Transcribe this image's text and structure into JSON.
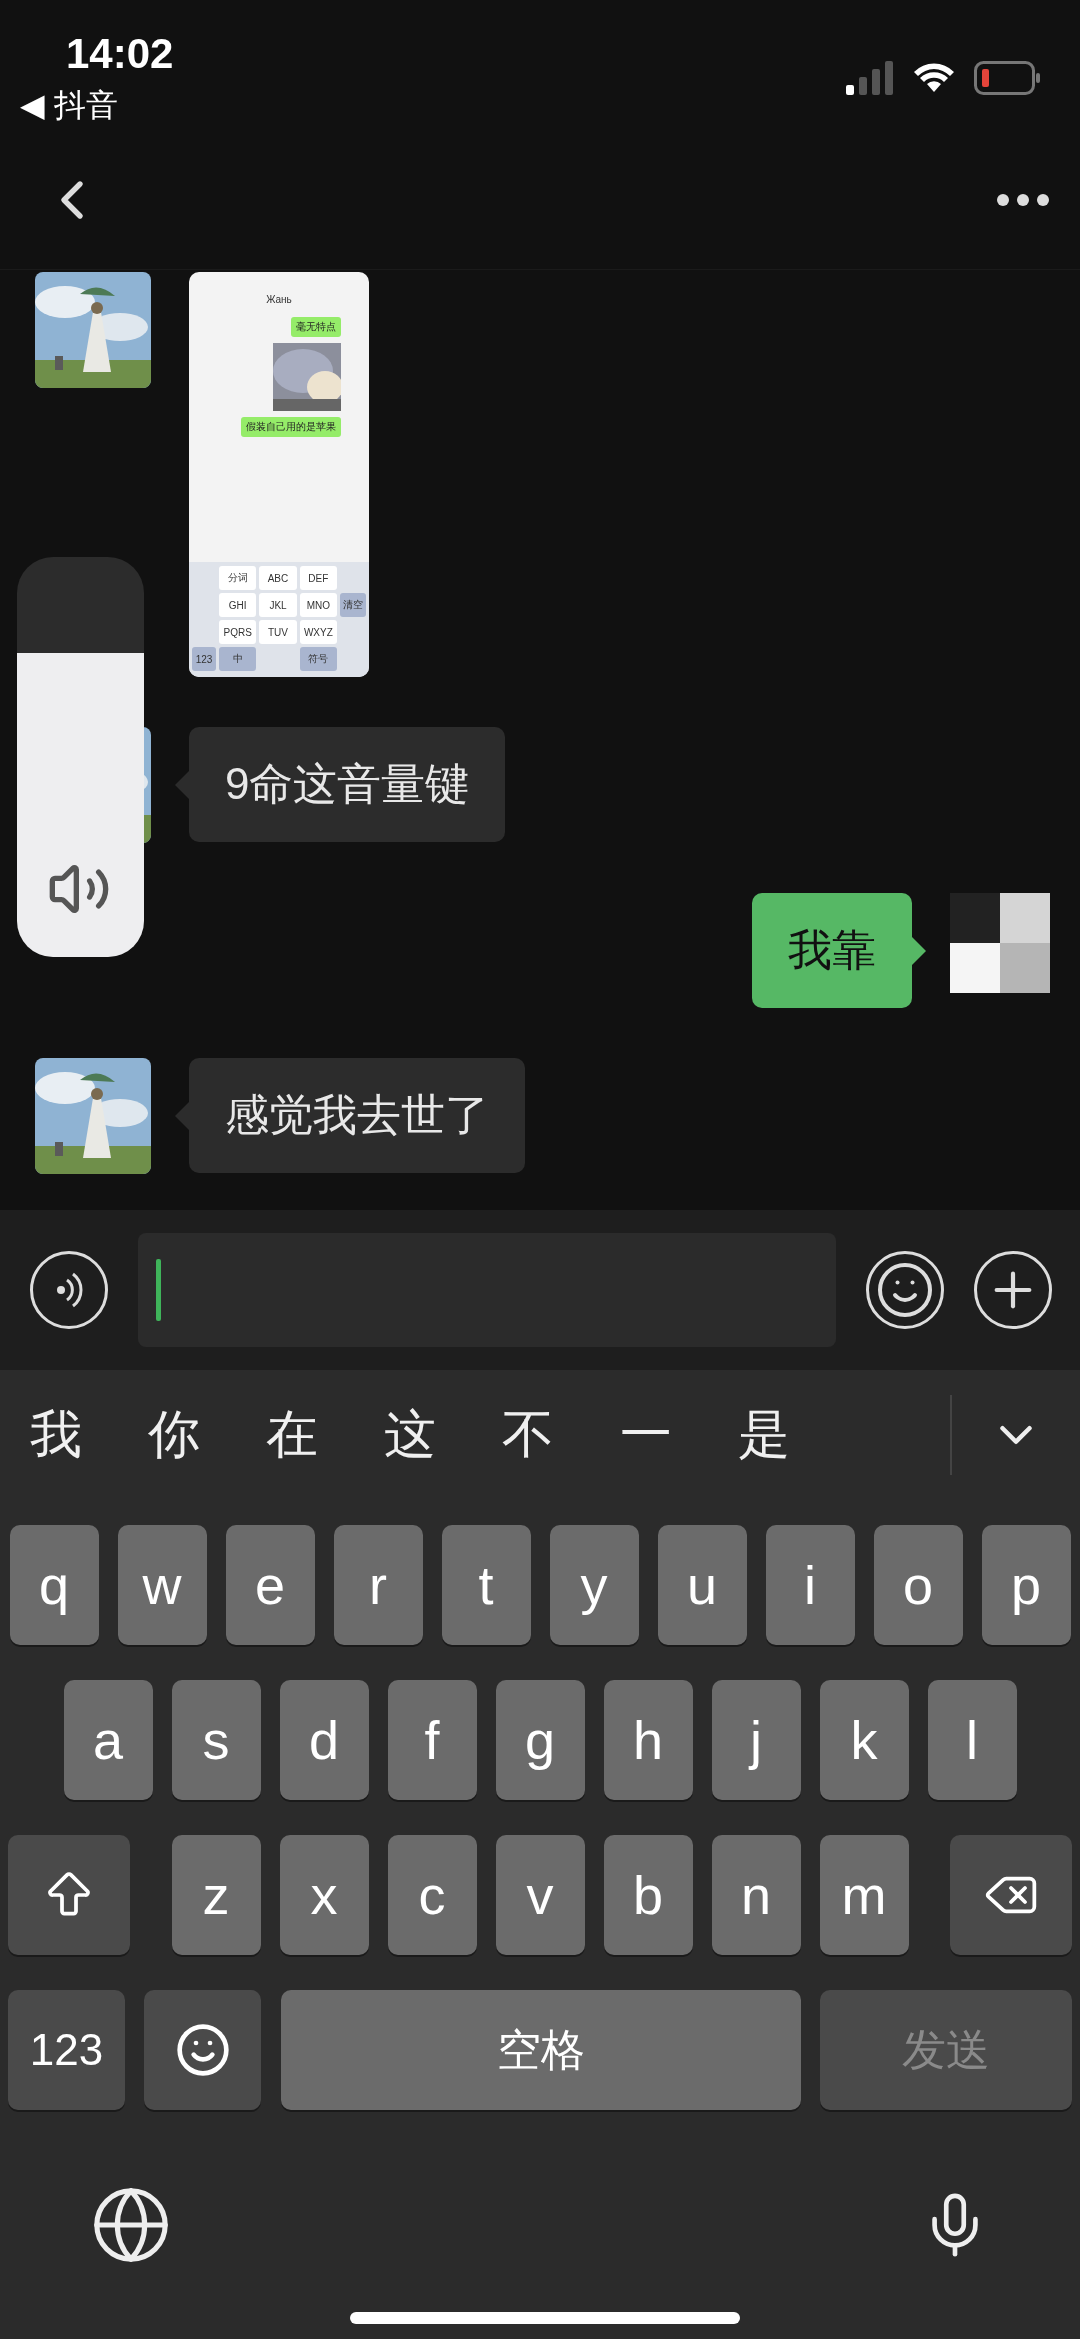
{
  "status_bar": {
    "time": "14:02",
    "back_app": "◀ 抖音"
  },
  "messages": [
    {
      "outgoing": false,
      "screenshot": {
        "title": "Жань",
        "bubbles": [
          "毫无特点",
          "假装自己用的是苹果"
        ],
        "keys": [
          [
            "分词",
            "ABC",
            "DEF"
          ],
          [
            "GHI",
            "JKL",
            "MNO"
          ],
          [
            "PQRS",
            "TUV",
            "WXYZ"
          ]
        ],
        "side_key": "清空",
        "bottom_keys": [
          "123",
          "中",
          "符号"
        ]
      }
    },
    {
      "kind": "text",
      "outgoing": false,
      "text": "9命这音量键"
    },
    {
      "kind": "text",
      "outgoing": true,
      "text": "我靠"
    },
    {
      "kind": "text",
      "outgoing": false,
      "text": "感觉我去世了"
    }
  ],
  "volume_overlay": {
    "level": 0.76
  },
  "keyboard": {
    "candidates": [
      "我",
      "你",
      "在",
      "这",
      "不",
      "一",
      "是"
    ],
    "rows": [
      [
        "q",
        "w",
        "e",
        "r",
        "t",
        "y",
        "u",
        "i",
        "o",
        "p"
      ],
      [
        "a",
        "s",
        "d",
        "f",
        "g",
        "h",
        "j",
        "k",
        "l"
      ],
      [
        "z",
        "x",
        "c",
        "v",
        "b",
        "n",
        "m"
      ]
    ],
    "numbers_key": "123",
    "space_key": "空格",
    "send_key": {
      "label": "发送",
      "disabled": true
    }
  }
}
